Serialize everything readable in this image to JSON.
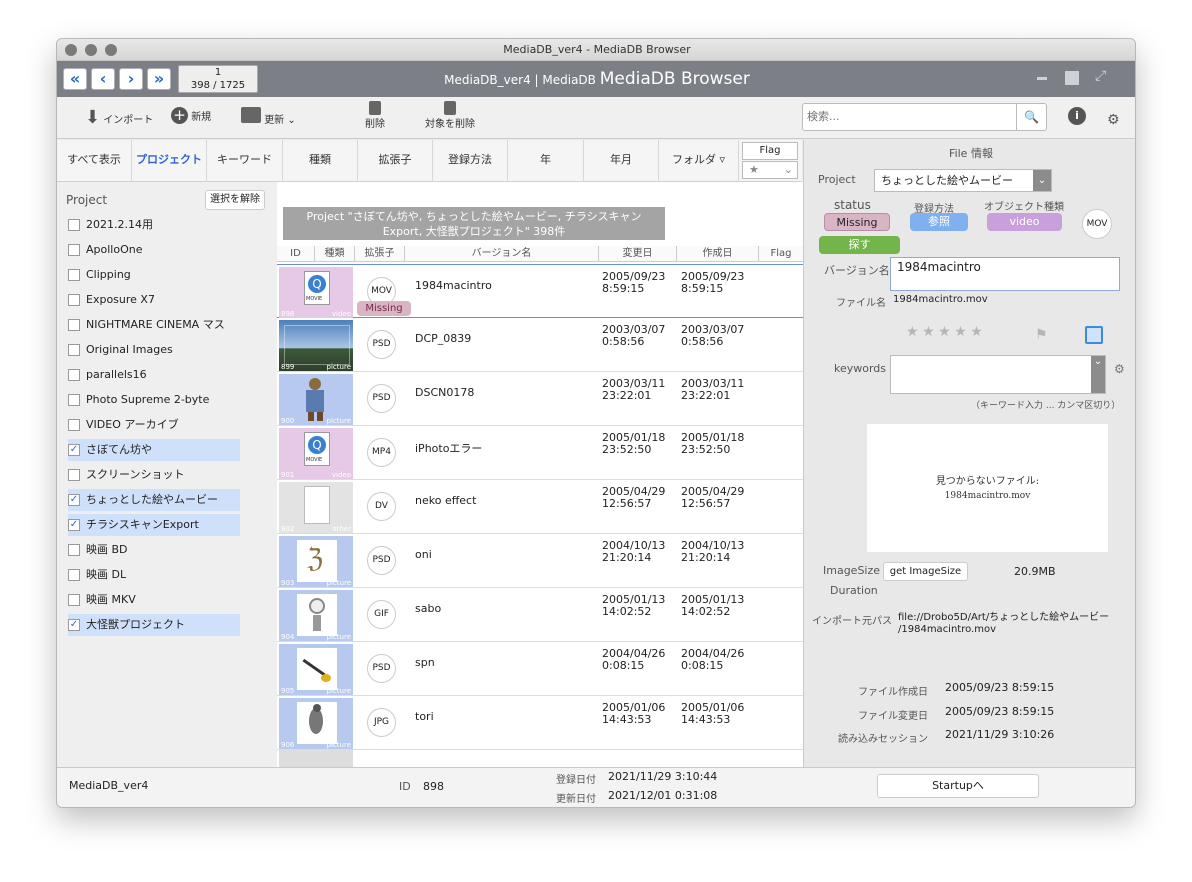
{
  "window": {
    "title": "MediaDB_ver4 - MediaDB Browser"
  },
  "header": {
    "record_current": "1",
    "record_total": "398 / 1725",
    "title_small": "MediaDB_ver4 | MediaDB",
    "title_big": "MediaDB Browser"
  },
  "toolbar": {
    "import": "インポート",
    "new": "新規",
    "update": "更新",
    "delete": "削除",
    "delete_target": "対象を削除",
    "search_placeholder": "検索..."
  },
  "tabs": [
    "すべて表示",
    "プロジェクト",
    "キーワード",
    "種類",
    "拡張子",
    "登録方法",
    "年",
    "年月",
    "フォルダ"
  ],
  "flag_tab": {
    "label": "Flag",
    "value": "★"
  },
  "sidebar": {
    "title": "Project",
    "clear_button": "選択を解除",
    "items": [
      {
        "label": "2021.2.14用",
        "checked": false
      },
      {
        "label": "ApolloOne",
        "checked": false
      },
      {
        "label": "Clipping",
        "checked": false
      },
      {
        "label": "Exposure X7",
        "checked": false
      },
      {
        "label": "NIGHTMARE CINEMA マス",
        "checked": false
      },
      {
        "label": "Original Images",
        "checked": false
      },
      {
        "label": "parallels16",
        "checked": false
      },
      {
        "label": "Photo Supreme 2-byte",
        "checked": false
      },
      {
        "label": "VIDEO アーカイブ",
        "checked": false
      },
      {
        "label": "さぼてん坊や",
        "checked": true
      },
      {
        "label": "スクリーンショット",
        "checked": false
      },
      {
        "label": "ちょっとした絵やムービー",
        "checked": true
      },
      {
        "label": "チラシスキャンExport",
        "checked": true
      },
      {
        "label": "映画 BD",
        "checked": false
      },
      {
        "label": "映画 DL",
        "checked": false
      },
      {
        "label": "映画 MKV",
        "checked": false
      },
      {
        "label": "大怪獣プロジェクト",
        "checked": true
      }
    ]
  },
  "list": {
    "banner_line1": "Project \"さぼてん坊や, ちょっとした絵やムービー, チラシスキャン",
    "banner_line2": "Export, 大怪獣プロジェクト\"  398件",
    "columns": [
      "ID",
      "種類",
      "拡張子",
      "バージョン名",
      "変更日",
      "作成日",
      "Flag"
    ],
    "rows": [
      {
        "id": "898",
        "type": "video",
        "ext": "MOV",
        "name": "1984macintro",
        "modified": "2005/09/23 8:59:15",
        "created": "2005/09/23 8:59:15",
        "status": "Missing",
        "thumb": "movie"
      },
      {
        "id": "899",
        "type": "picture",
        "ext": "PSD",
        "name": "DCP_0839",
        "modified": "2003/03/07 0:58:56",
        "created": "2003/03/07 0:58:56",
        "thumb": "sky"
      },
      {
        "id": "900",
        "type": "picture",
        "ext": "PSD",
        "name": "DSCN0178",
        "modified": "2003/03/11 23:22:01",
        "created": "2003/03/11 23:22:01",
        "thumb": "figure"
      },
      {
        "id": "901",
        "type": "video",
        "ext": "MP4",
        "name": "iPhotoエラー",
        "modified": "2005/01/18 23:52:50",
        "created": "2005/01/18 23:52:50",
        "thumb": "movie"
      },
      {
        "id": "902",
        "type": "other",
        "ext": "DV",
        "name": "neko effect",
        "modified": "2005/04/29 12:56:57",
        "created": "2005/04/29 12:56:57",
        "thumb": "doc"
      },
      {
        "id": "903",
        "type": "picture",
        "ext": "PSD",
        "name": "oni",
        "modified": "2004/10/13 21:20:14",
        "created": "2004/10/13 21:20:14",
        "thumb": "oni"
      },
      {
        "id": "904",
        "type": "picture",
        "ext": "GIF",
        "name": "sabo",
        "modified": "2005/01/13 14:02:52",
        "created": "2005/01/13 14:02:52",
        "thumb": "sabo"
      },
      {
        "id": "905",
        "type": "picture",
        "ext": "PSD",
        "name": "spn",
        "modified": "2004/04/26 0:08:15",
        "created": "2004/04/26 0:08:15",
        "thumb": "spoon"
      },
      {
        "id": "906",
        "type": "picture",
        "ext": "JPG",
        "name": "tori",
        "modified": "2005/01/06 14:43:53",
        "created": "2005/01/06 14:43:53",
        "thumb": "bird"
      }
    ]
  },
  "detail": {
    "header": "File 情報",
    "project_label": "Project",
    "project_value": "ちょっとした絵やムービー",
    "status_label": "status",
    "status_value": "Missing",
    "reg_label": "登録方法",
    "reg_value": "参照",
    "objtype_label": "オブジェクト種類",
    "objtype_value": "video",
    "ext_badge": "MOV",
    "find_button": "探す",
    "version_label": "バージョン名",
    "version_value": "1984macintro",
    "filename_label": "ファイル名",
    "filename_value": "1984macintro.mov",
    "keywords_label": "keywords",
    "keywords_hint": "（キーワード入力 ... カンマ区切り）",
    "missing_line1": "見つからないファイル:",
    "missing_line2": "1984macintro.mov",
    "imagesize_label": "ImageSize",
    "imagesize_button": "get ImageSize",
    "filesize": "20.9MB",
    "duration_label": "Duration",
    "import_label": "インポート元パス",
    "import_value1": "file://Drobo5D/Art/ちょっとした絵やムービー",
    "import_value2": "/1984macintro.mov",
    "fcreated_label": "ファイル作成日",
    "fcreated_value": "2005/09/23 8:59:15",
    "fmodified_label": "ファイル変更日",
    "fmodified_value": "2005/09/23 8:59:15",
    "session_label": "読み込みセッション",
    "session_value": "2021/11/29 3:10:26"
  },
  "footer": {
    "db": "MediaDB_ver4",
    "id_label": "ID",
    "id_value": "898",
    "reg_date_label": "登録日付",
    "reg_date_value": "2021/11/29 3:10:44",
    "upd_date_label": "更新日付",
    "upd_date_value": "2021/12/01 0:31:08",
    "startup_button": "Startupへ"
  },
  "colors": {
    "accent": "#2f63d6",
    "missing": "#d8b4c4",
    "ref": "#7fb0f0",
    "video": "#c9a0dc",
    "find": "#73b54a",
    "header": "#7c7f86"
  }
}
